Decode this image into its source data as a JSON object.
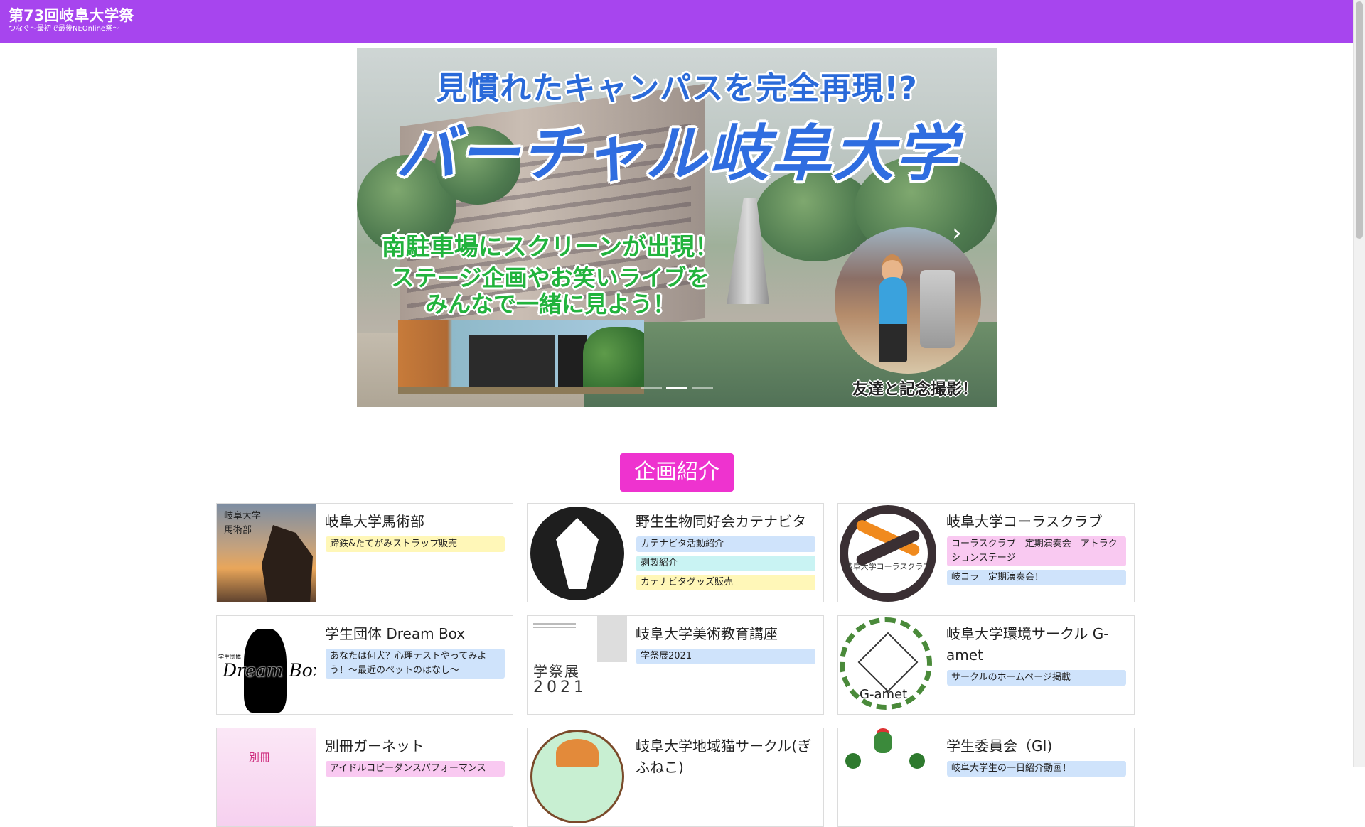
{
  "header": {
    "title": "第73回岐阜大学祭",
    "subtitle": "つなぐ〜最初で最後NEOnline祭〜",
    "background": "#a745ee"
  },
  "carousel": {
    "slide": {
      "headline_top": "見慣れたキャンパスを完全再現!?",
      "headline_main": "バーチャル岐阜大学",
      "green_lines": [
        "南駐車場にスクリーンが出現！",
        "ステージ企画やお笑いライブを",
        "みんなで一緒に見よう！"
      ],
      "photo_caption": "友達と記念撮影！"
    },
    "prev_icon": "chevron-left-icon",
    "next_icon": "chevron-right-icon",
    "prev_glyph": "‹",
    "next_glyph": "›",
    "indicator_count": 3,
    "active_indicator": 2
  },
  "section": {
    "title": "企画紹介",
    "accent": "#ee33cf"
  },
  "cards": [
    {
      "title": "岐阜大学馬術部",
      "thumb_text": "岐阜大学\n馬術部",
      "tags": [
        {
          "text": "蹄鉄&たてがみストラップ販売",
          "color": "yellow"
        }
      ]
    },
    {
      "title": "野生生物同好会カテナビタ",
      "tags": [
        {
          "text": "カテナビタ活動紹介",
          "color": "blue"
        },
        {
          "text": "剥製紹介",
          "color": "cyan"
        },
        {
          "text": "カテナビタグッズ販売",
          "color": "yellow"
        }
      ]
    },
    {
      "title": "岐阜大学コーラスクラブ",
      "thumb_text": "岐阜大学コーラスクラブ",
      "tags": [
        {
          "text": "コーラスクラブ　定期演奏会　アトラクションステージ",
          "color": "pink"
        },
        {
          "text": "岐コラ　定期演奏会！",
          "color": "blue"
        }
      ]
    },
    {
      "title": "学生団体 Dream Box",
      "thumb_text": "Dream Box",
      "thumb_small": "学生団体",
      "tags": [
        {
          "text": "あなたは何犬？心理テストやってみよう！〜最近のペットのはなし〜",
          "color": "blue"
        }
      ]
    },
    {
      "title": "岐阜大学美術教育講座",
      "thumb_text": "学祭展",
      "thumb_year": "2021",
      "tags": [
        {
          "text": "学祭展2021",
          "color": "blue"
        }
      ]
    },
    {
      "title": "岐阜大学環境サークル G-amet",
      "thumb_text": "G-amet",
      "tags": [
        {
          "text": "サークルのホームページ掲載",
          "color": "blue"
        }
      ]
    },
    {
      "title": "別冊ガーネット",
      "thumb_text": "別冊",
      "tags": [
        {
          "text": "アイドルコピーダンスパフォーマンス",
          "color": "pink"
        }
      ]
    },
    {
      "title": "岐阜大学地域猫サークル(ぎふねこ)",
      "tags": []
    },
    {
      "title": "学生委員会（GI)",
      "tags": [
        {
          "text": "岐阜大学生の一日紹介動画！",
          "color": "blue"
        }
      ]
    }
  ]
}
